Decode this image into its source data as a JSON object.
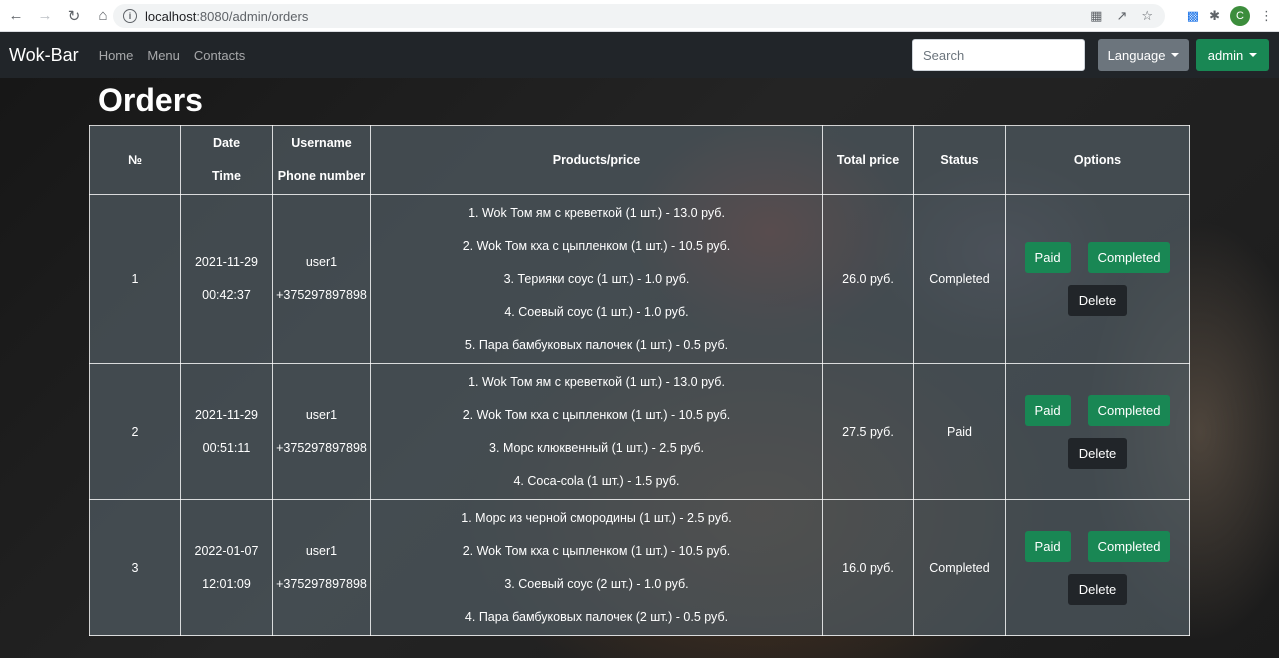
{
  "browser": {
    "url_host": "localhost",
    "url_path": ":8080/admin/orders",
    "profile_initial": "C"
  },
  "navbar": {
    "brand": "Wok-Bar",
    "links": [
      "Home",
      "Menu",
      "Contacts"
    ],
    "search_placeholder": "Search",
    "language_label": "Language",
    "admin_label": "admin"
  },
  "page": {
    "title": "Orders"
  },
  "table": {
    "headers": {
      "number": "№",
      "date": "Date",
      "time": "Time",
      "username": "Username",
      "phone": "Phone number",
      "products": "Products/price",
      "total": "Total price",
      "status": "Status",
      "options": "Options"
    },
    "rows": [
      {
        "number": "1",
        "date": "2021-11-29",
        "time": "00:42:37",
        "username": "user1",
        "phone": "+375297897898",
        "products": [
          "1. Wok Том ям с креветкой (1 шт.) - 13.0 руб.",
          "2. Wok Том кха с цыпленком (1 шт.) - 10.5 руб.",
          "3. Терияки соус (1 шт.) - 1.0 руб.",
          "4. Соевый соус (1 шт.) - 1.0 руб.",
          "5. Пара бамбуковых палочек (1 шт.) - 0.5 руб."
        ],
        "total": "26.0 руб.",
        "status": "Completed"
      },
      {
        "number": "2",
        "date": "2021-11-29",
        "time": "00:51:11",
        "username": "user1",
        "phone": "+375297897898",
        "products": [
          "1. Wok Том ям с креветкой (1 шт.) - 13.0 руб.",
          "2. Wok Том кха с цыпленком (1 шт.) - 10.5 руб.",
          "3. Морс клюквенный (1 шт.) - 2.5 руб.",
          "4. Coca-cola (1 шт.) - 1.5 руб."
        ],
        "total": "27.5 руб.",
        "status": "Paid"
      },
      {
        "number": "3",
        "date": "2022-01-07",
        "time": "12:01:09",
        "username": "user1",
        "phone": "+375297897898",
        "products": [
          "1. Морс из черной смородины (1 шт.) - 2.5 руб.",
          "2. Wok Том кха с цыпленком (1 шт.) - 10.5 руб.",
          "3. Соевый соус (2 шт.) - 1.0 руб.",
          "4. Пара бамбуковых палочек (2 шт.) - 0.5 руб."
        ],
        "total": "16.0 руб.",
        "status": "Completed"
      }
    ],
    "option_labels": {
      "paid": "Paid",
      "completed": "Completed",
      "delete": "Delete"
    }
  }
}
